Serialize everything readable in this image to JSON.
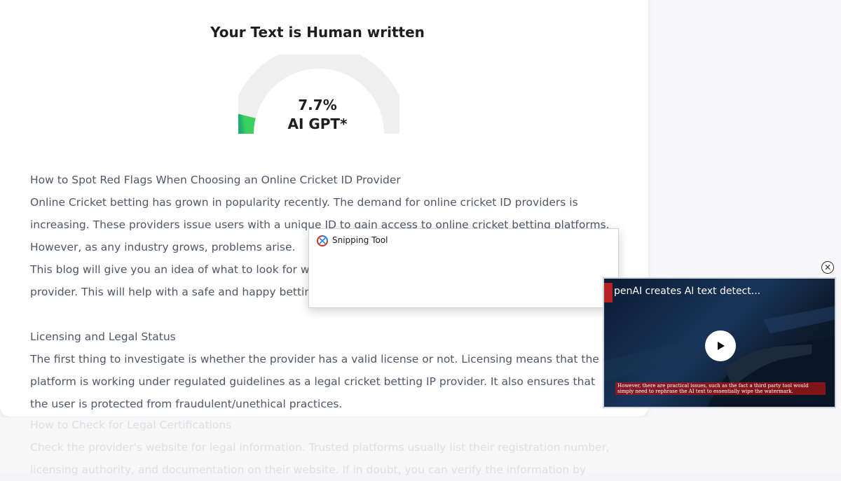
{
  "result": {
    "title": "Your Text is Human written",
    "percent": "7.7%",
    "percent_value": 7.7,
    "label": "AI GPT*"
  },
  "colors": {
    "gauge_fill_start": "#1fae6f",
    "gauge_fill_end": "#3ccf5f",
    "gauge_track": "#efefef",
    "text": "#51566a"
  },
  "article": {
    "lines": [
      "How to Spot Red Flags When Choosing an Online Cricket ID Provider",
      "Online Cricket betting has grown in popularity recently. The demand for online cricket ID providers is",
      "increasing. These providers issue users with a unique ID to gain access to online cricket betting platforms.",
      "However, as any industry grows, problems arise.",
      "This blog will give you an idea of what to look for w",
      "provider. This will help with a safe and happy bettin",
      "",
      "Licensing and Legal Status",
      "The first thing to investigate is whether the provider has a valid license or not. Licensing means that the",
      "platform is working under regulated guidelines as a legal cricket betting IP provider. It also ensures that",
      "the user is protected from fraudulent/unethical practices."
    ],
    "faded_lines": [
      "How to Check for Legal Certifications",
      "Check the provider's website for legal information. Trusted platforms usually list their registration number,",
      "licensing authority, and documentation on their website. If in doubt, you can verify the information by"
    ]
  },
  "snipping_tool": {
    "title": "Snipping Tool",
    "icon": "scissors-icon"
  },
  "video": {
    "title": "penAI creates AI text detect...",
    "caption": "However, there are practical issues, such as the fact a third party tool would simply need to rephrase the AI text to essentially wipe the watermark.",
    "close_icon": "close-circle-icon",
    "play_icon": "play-icon"
  }
}
